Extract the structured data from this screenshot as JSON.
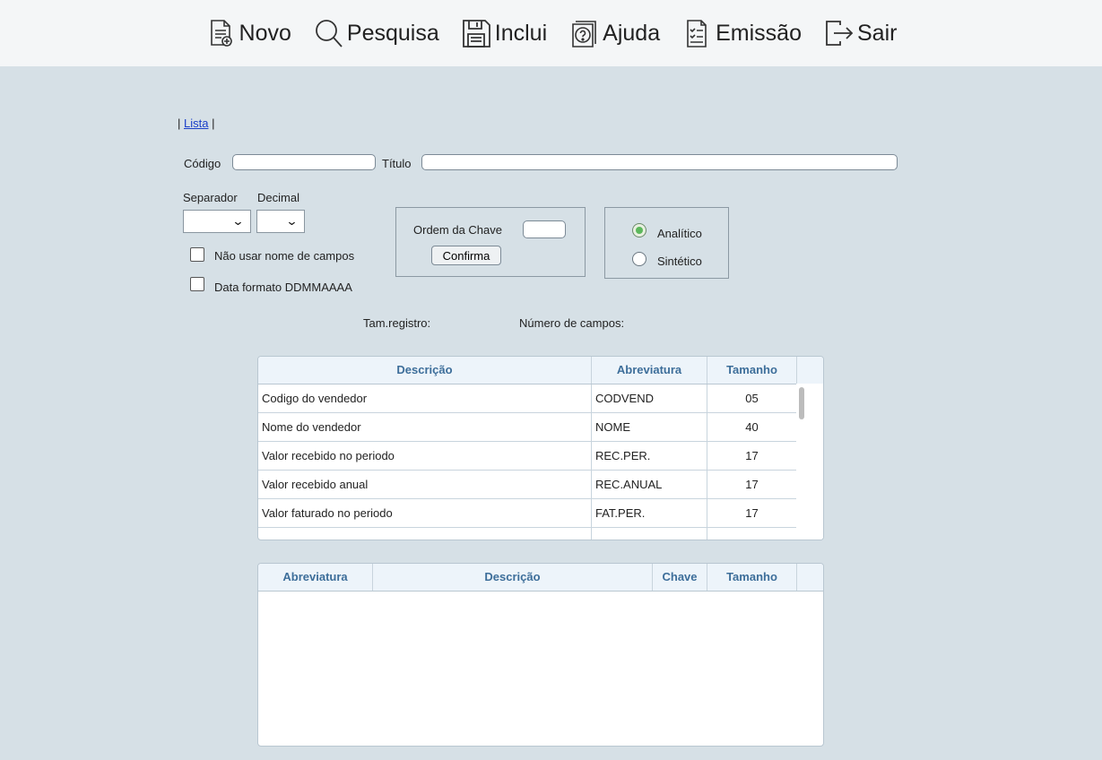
{
  "toolbar": {
    "items": [
      {
        "label": "Novo",
        "icon": "new-document-icon"
      },
      {
        "label": "Pesquisa",
        "icon": "search-icon"
      },
      {
        "label": "Inclui",
        "icon": "save-icon"
      },
      {
        "label": "Ajuda",
        "icon": "help-icon"
      },
      {
        "label": "Emissão",
        "icon": "report-icon"
      },
      {
        "label": "Sair",
        "icon": "exit-icon"
      }
    ]
  },
  "nav": {
    "prefix": "| ",
    "lista": "Lista",
    "suffix": " |"
  },
  "form": {
    "codigo_label": "Código",
    "codigo_value": "",
    "titulo_label": "Título",
    "titulo_value": "",
    "separador_label": "Separador",
    "separador_value": "",
    "decimal_label": "Decimal",
    "decimal_value": "",
    "nao_usar_label": "Não usar nome de campos",
    "data_formato_label": "Data formato DDMMAAAA",
    "ordem_chave_label": "Ordem da Chave",
    "ordem_chave_value": "",
    "confirma_label": "Confirma",
    "analitico_label": "Analítico",
    "sintetico_label": "Sintético",
    "selected_mode": "Analítico",
    "tam_registro_label": "Tam.registro:",
    "numero_campos_label": "Número de campos:"
  },
  "fields_table": {
    "headers": [
      "Descrição",
      "Abreviatura",
      "Tamanho"
    ],
    "rows": [
      [
        "Codigo do vendedor",
        "CODVEND",
        "05"
      ],
      [
        "Nome do vendedor",
        "NOME",
        "40"
      ],
      [
        "Valor recebido no periodo",
        "REC.PER.",
        "17"
      ],
      [
        "Valor recebido anual",
        "REC.ANUAL",
        "17"
      ],
      [
        "Valor faturado no periodo",
        "FAT.PER.",
        "17"
      ]
    ]
  },
  "selected_table": {
    "headers": [
      "Abreviatura",
      "Descrição",
      "Chave",
      "Tamanho"
    ],
    "rows": []
  },
  "colors": {
    "background": "#d6e0e6",
    "header_text": "#3d6e9a",
    "radio_on": "#5cb85c"
  }
}
